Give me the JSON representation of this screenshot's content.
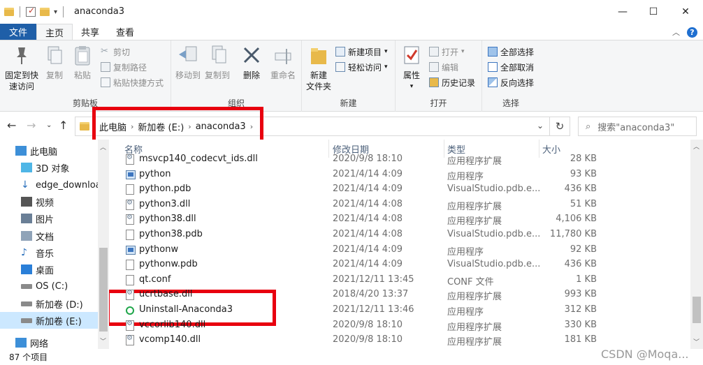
{
  "window": {
    "title": "anaconda3",
    "minimize": "—",
    "maximize": "☐",
    "close": "✕"
  },
  "ribbon_tabs": [
    "文件",
    "主页",
    "共享",
    "查看"
  ],
  "ribbon": {
    "clipboard": {
      "pin": "固定到快\n速访问",
      "copy": "复制",
      "paste": "粘贴",
      "cut": "剪切",
      "copy_path": "复制路径",
      "paste_shortcut": "粘贴快捷方式",
      "label": "剪贴板"
    },
    "organize": {
      "move_to": "移动到",
      "copy_to": "复制到",
      "delete": "删除",
      "rename": "重命名",
      "label": "组织"
    },
    "new": {
      "new_folder": "新建\n文件夹",
      "new_item": "新建项目",
      "easy_access": "轻松访问",
      "label": "新建"
    },
    "open": {
      "properties": "属性",
      "open": "打开",
      "edit": "编辑",
      "history": "历史记录",
      "label": "打开"
    },
    "select": {
      "select_all": "全部选择",
      "select_none": "全部取消",
      "invert": "反向选择",
      "label": "选择"
    }
  },
  "address": {
    "crumbs": [
      "此电脑",
      "新加卷 (E:)",
      "anaconda3"
    ],
    "search_placeholder": "搜索\"anaconda3\""
  },
  "sidebar": {
    "items": [
      {
        "label": "此电脑",
        "icon": "pc-icon"
      },
      {
        "label": "3D 对象",
        "icon": "cube-icon"
      },
      {
        "label": "edge_download",
        "icon": "download-icon"
      },
      {
        "label": "视频",
        "icon": "video-icon"
      },
      {
        "label": "图片",
        "icon": "picture-icon"
      },
      {
        "label": "文档",
        "icon": "document-icon"
      },
      {
        "label": "音乐",
        "icon": "music-icon"
      },
      {
        "label": "桌面",
        "icon": "desktop-icon"
      },
      {
        "label": "OS (C:)",
        "icon": "drive-icon"
      },
      {
        "label": "新加卷 (D:)",
        "icon": "drive-icon"
      },
      {
        "label": "新加卷 (E:)",
        "icon": "drive-icon"
      },
      {
        "label": "网络",
        "icon": "network-icon"
      }
    ]
  },
  "columns": {
    "name": "名称",
    "date": "修改日期",
    "type": "类型",
    "size": "大小"
  },
  "files": [
    {
      "name": "msvcp140_codecvt_ids.dll",
      "date": "2020/9/8 18:10",
      "type": "应用程序扩展",
      "size": "28 KB",
      "icon": "dll"
    },
    {
      "name": "python",
      "date": "2021/4/14 4:09",
      "type": "应用程序",
      "size": "93 KB",
      "icon": "python"
    },
    {
      "name": "python.pdb",
      "date": "2021/4/14 4:09",
      "type": "VisualStudio.pdb.e...",
      "size": "436 KB",
      "icon": "file"
    },
    {
      "name": "python3.dll",
      "date": "2021/4/14 4:08",
      "type": "应用程序扩展",
      "size": "51 KB",
      "icon": "dll"
    },
    {
      "name": "python38.dll",
      "date": "2021/4/14 4:08",
      "type": "应用程序扩展",
      "size": "4,106 KB",
      "icon": "dll"
    },
    {
      "name": "python38.pdb",
      "date": "2021/4/14 4:08",
      "type": "VisualStudio.pdb.e...",
      "size": "11,780 KB",
      "icon": "file"
    },
    {
      "name": "pythonw",
      "date": "2021/4/14 4:09",
      "type": "应用程序",
      "size": "92 KB",
      "icon": "python"
    },
    {
      "name": "pythonw.pdb",
      "date": "2021/4/14 4:09",
      "type": "VisualStudio.pdb.e...",
      "size": "436 KB",
      "icon": "file"
    },
    {
      "name": "qt.conf",
      "date": "2021/12/11 13:45",
      "type": "CONF 文件",
      "size": "1 KB",
      "icon": "file"
    },
    {
      "name": "ucrtbase.dll",
      "date": "2018/4/20 13:37",
      "type": "应用程序扩展",
      "size": "993 KB",
      "icon": "dll"
    },
    {
      "name": "Uninstall-Anaconda3",
      "date": "2021/12/11 13:46",
      "type": "应用程序",
      "size": "312 KB",
      "icon": "uninstall"
    },
    {
      "name": "vccorlib140.dll",
      "date": "2020/9/8 18:10",
      "type": "应用程序扩展",
      "size": "330 KB",
      "icon": "dll"
    },
    {
      "name": "vcomp140.dll",
      "date": "2020/9/8 18:10",
      "type": "应用程序扩展",
      "size": "181 KB",
      "icon": "dll"
    }
  ],
  "status": {
    "count": "87 个项目"
  },
  "watermark": "CSDN @Moqa..."
}
